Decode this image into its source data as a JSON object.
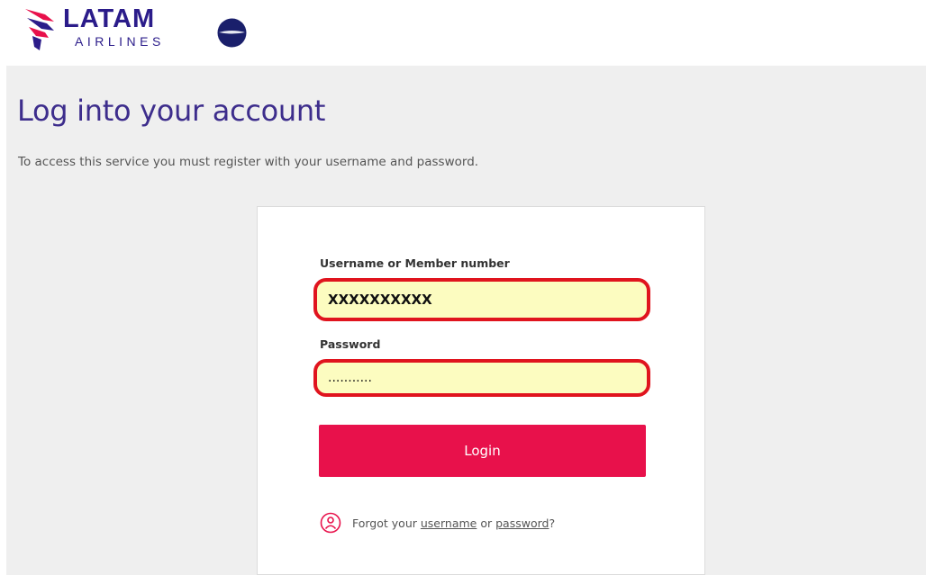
{
  "brand": {
    "name": "LATAM",
    "subname": "AIRLINES",
    "colors": {
      "primary": "#2b1c8a",
      "accent": "#e8114b"
    },
    "alliance_icon": "oneworld-globe-icon"
  },
  "page": {
    "title": "Log into your account",
    "subtitle": "To access this service you must register with your username and password."
  },
  "login_form": {
    "username_label": "Username or Member number",
    "username_value": "XXXXXXXXXX",
    "password_label": "Password",
    "password_value": "...........",
    "login_button": "Login",
    "forgot": {
      "icon": "user-help-icon",
      "prefix": "Forgot your",
      "username_link": "username",
      "connector": "or",
      "password_link": "password",
      "suffix": "?"
    }
  }
}
